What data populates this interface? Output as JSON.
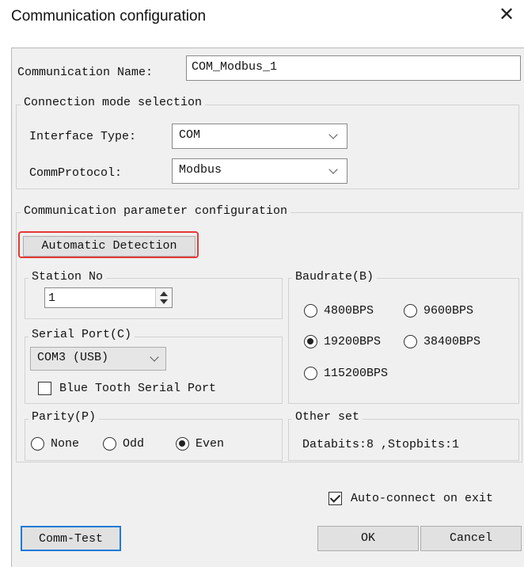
{
  "window": {
    "title": "Communication configuration",
    "close_glyph": "✕"
  },
  "comm_name": {
    "label": "Communication Name:",
    "value": "COM_Modbus_1"
  },
  "connection": {
    "title": "Connection mode selection",
    "interface_label": "Interface Type:",
    "interface_value": "COM",
    "protocol_label": "CommProtocol:",
    "protocol_value": "Modbus"
  },
  "params": {
    "title": "Communication parameter configuration",
    "auto_detect_label": "Automatic Detection",
    "highlight_color": "#e53935"
  },
  "station": {
    "title": "Station No",
    "value": "1"
  },
  "serial": {
    "title": "Serial Port(C)",
    "value": "COM3  (USB)",
    "bluetooth_label": "Blue Tooth Serial Port",
    "bluetooth_checked": false
  },
  "baud": {
    "title": "Baudrate(B)",
    "options": [
      "4800BPS",
      "9600BPS",
      "19200BPS",
      "38400BPS",
      "115200BPS"
    ],
    "selected": "19200BPS"
  },
  "parity": {
    "title": "Parity(P)",
    "options": [
      "None",
      "Odd",
      "Even"
    ],
    "selected": "Even"
  },
  "other": {
    "title": "Other set",
    "text": "Databits:8 ,Stopbits:1"
  },
  "auto_connect": {
    "label": "Auto-connect on exit",
    "checked": true
  },
  "buttons": {
    "test": "Comm-Test",
    "ok": "OK",
    "cancel": "Cancel"
  },
  "accent": "#1e7bd6"
}
